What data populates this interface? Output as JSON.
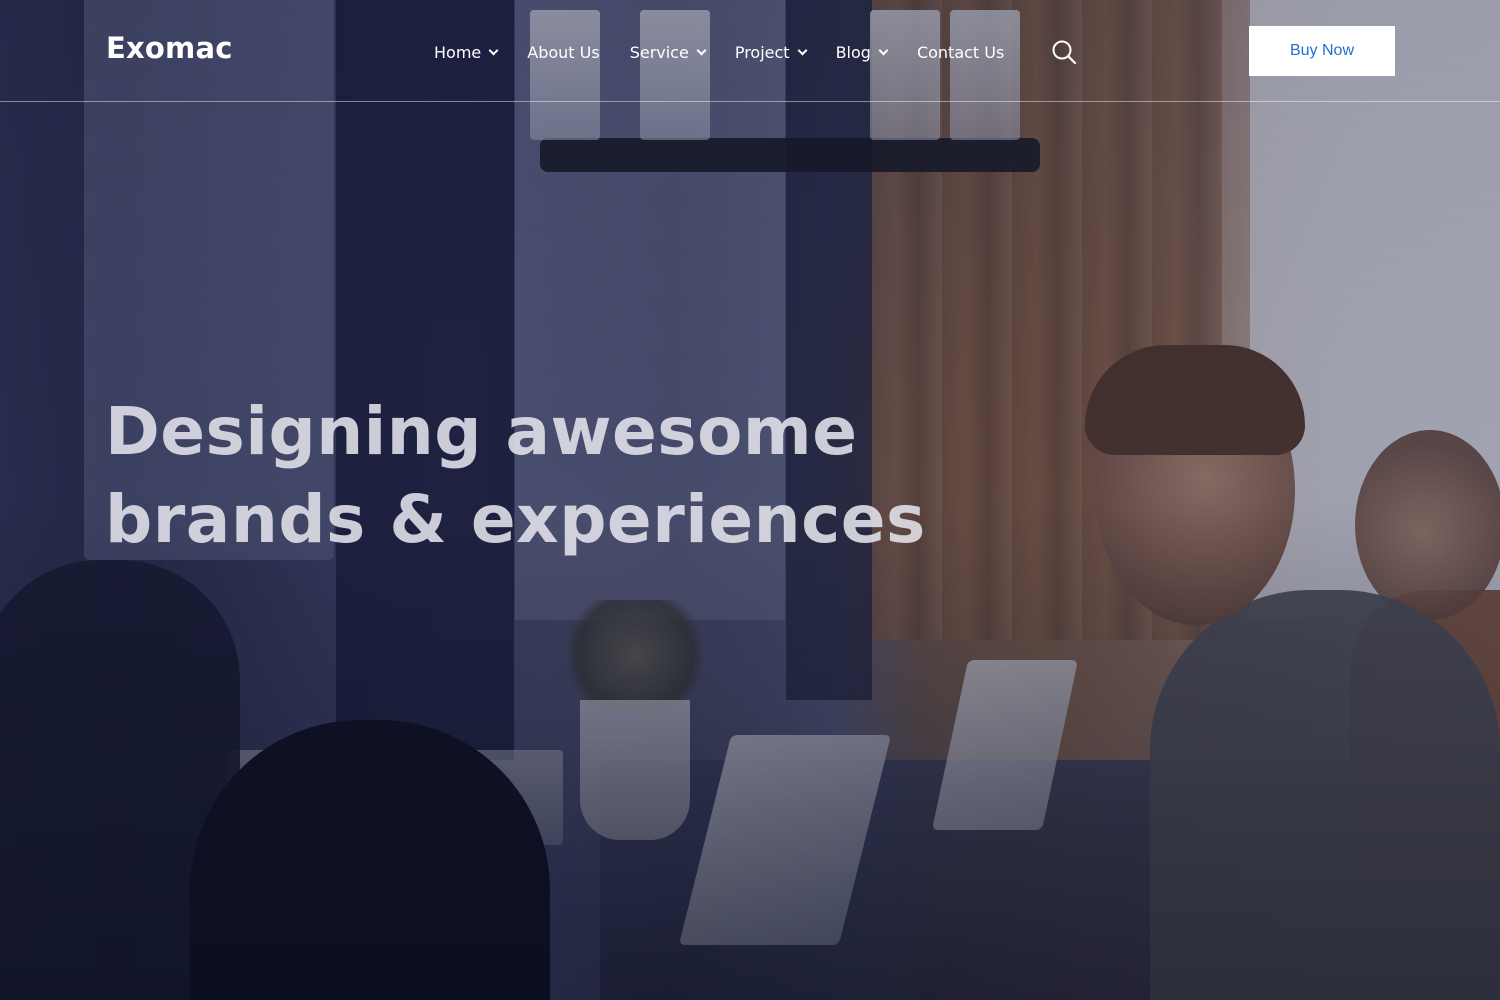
{
  "header": {
    "logo": "Exomac",
    "nav": [
      {
        "label": "Home",
        "has_dropdown": true
      },
      {
        "label": "About Us",
        "has_dropdown": false
      },
      {
        "label": "Service",
        "has_dropdown": true
      },
      {
        "label": "Project",
        "has_dropdown": true
      },
      {
        "label": "Blog",
        "has_dropdown": true
      },
      {
        "label": "Contact Us",
        "has_dropdown": false
      }
    ],
    "search_icon": "search-icon",
    "cta_label": "Buy Now"
  },
  "hero": {
    "title_line_1": "Designing awesome",
    "title_line_2": "brands & experiences"
  },
  "colors": {
    "accent": "#1f6fd1",
    "header_text": "#ffffff",
    "overlay": "#101430"
  }
}
